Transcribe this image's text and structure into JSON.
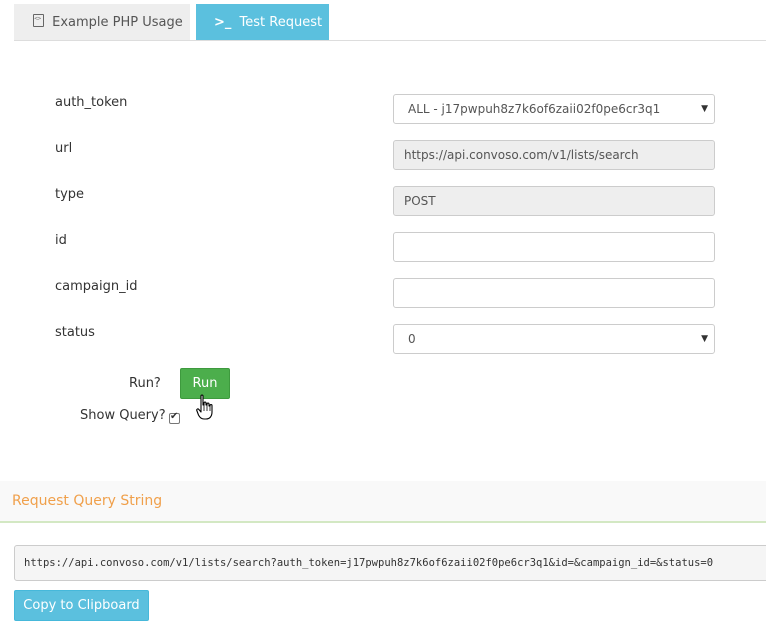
{
  "tabs": [
    {
      "label": "Example PHP Usage",
      "icon": "file-code-icon"
    },
    {
      "label": "Test Request",
      "icon": "terminal-icon",
      "active": true
    }
  ],
  "form": {
    "fields": [
      {
        "label": "auth_token",
        "value": "ALL - j17pwpuh8z7k6of6zaii02f0pe6cr3q1",
        "kind": "select"
      },
      {
        "label": "url",
        "value": "https://api.convoso.com/v1/lists/search",
        "kind": "readonly"
      },
      {
        "label": "type",
        "value": "POST",
        "kind": "readonly"
      },
      {
        "label": "id",
        "value": "",
        "kind": "input"
      },
      {
        "label": "campaign_id",
        "value": "",
        "kind": "input"
      },
      {
        "label": "status",
        "value": "0",
        "kind": "select"
      }
    ],
    "run_label": "Run?",
    "run_button": "Run",
    "show_query_label": "Show Query?",
    "show_query_checked": true
  },
  "query_panel": {
    "title": "Request Query String",
    "query": "https://api.convoso.com/v1/lists/search?auth_token=j17pwpuh8z7k6of6zaii02f0pe6cr3q1&id=&campaign_id=&status=0",
    "copy_button": "Copy to Clipboard"
  },
  "colors": {
    "accent": "#5bc0de",
    "run": "#4cae4c",
    "panel_title": "#f0a04b"
  }
}
